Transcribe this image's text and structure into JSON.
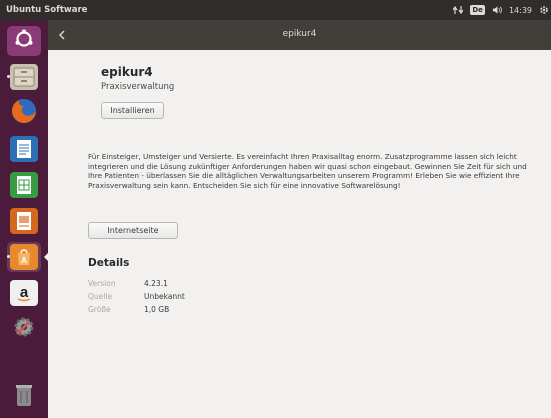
{
  "panel": {
    "app_title": "Ubuntu Software",
    "keyboard_layout": "De",
    "clock": "14:39"
  },
  "launcher": {
    "items": [
      {
        "name": "ubuntu-dash",
        "icon": "ubuntu-logo-icon",
        "color": "#8a3a74"
      },
      {
        "name": "files",
        "icon": "file-cabinet-icon",
        "color": "#c9c0b0"
      },
      {
        "name": "firefox",
        "icon": "firefox-icon",
        "color": "#e66a1d"
      },
      {
        "name": "writer",
        "icon": "document-writer-icon",
        "color": "#2f6fb6"
      },
      {
        "name": "calc",
        "icon": "spreadsheet-calc-icon",
        "color": "#3a9a43"
      },
      {
        "name": "impress",
        "icon": "presentation-impress-icon",
        "color": "#d2691e"
      },
      {
        "name": "software-center",
        "icon": "software-center-icon",
        "color": "#e8892d"
      },
      {
        "name": "amazon",
        "icon": "amazon-icon",
        "color": "#f0f0f0"
      },
      {
        "name": "settings",
        "icon": "system-settings-icon",
        "color": "#c65b5b"
      },
      {
        "name": "trash",
        "icon": "trash-icon",
        "color": "#7a7a7a"
      }
    ]
  },
  "header": {
    "title": "epikur4"
  },
  "app": {
    "name": "epikur4",
    "summary": "Praxisverwaltung",
    "install_label": "Installieren",
    "description": "Für Einsteiger, Umsteiger und Versierte. Es vereinfacht Ihren Praxisalltag enorm. Zusatzprogramme lassen sich leicht integrieren und die Lösung zukünftiger Anforderungen haben wir quasi schon eingebaut. Gewinnen Sie Zeit für sich und Ihre Patienten - überlassen Sie die alltäglichen Verwaltungsarbeiten unserem Programm! Erleben Sie wie effizient Ihre Praxisverwaltung sein kann. Entscheiden Sie sich für eine innovative Softwarelösung!",
    "website_label": "Internetseite"
  },
  "details": {
    "heading": "Details",
    "rows": [
      {
        "label": "Version",
        "value": "4.23.1"
      },
      {
        "label": "Quelle",
        "value": "Unbekannt"
      },
      {
        "label": "Größe",
        "value": "1,0 GB"
      }
    ]
  }
}
